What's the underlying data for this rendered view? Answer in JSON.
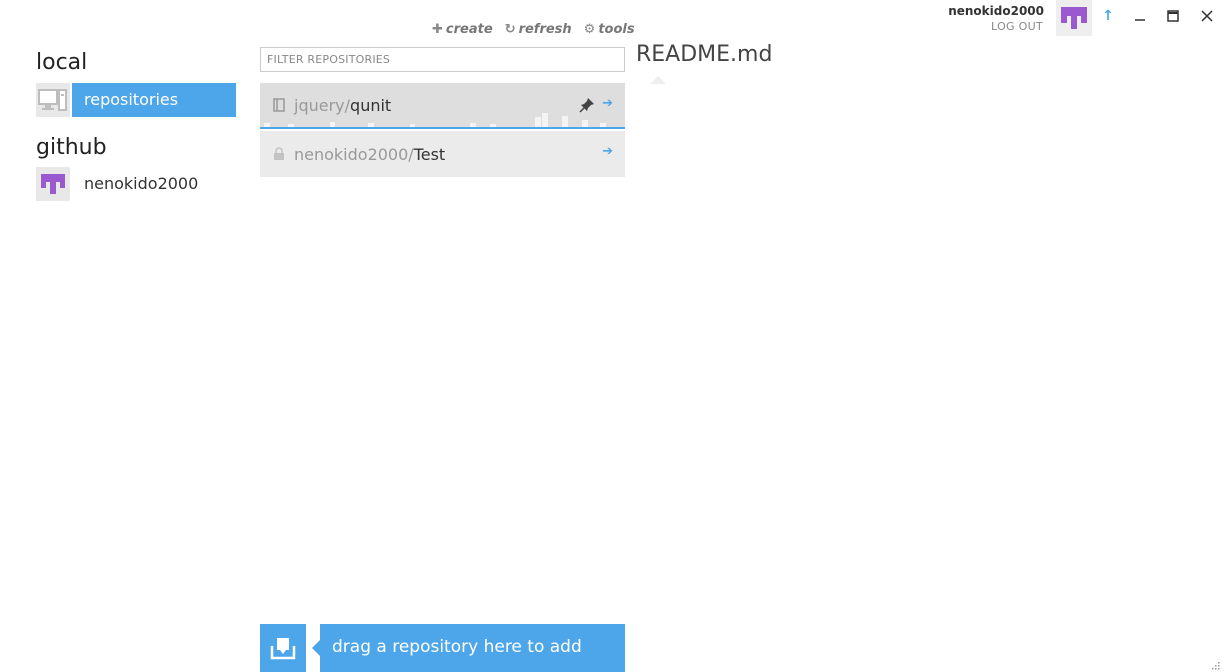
{
  "sidebar": {
    "local_title": "local",
    "local_items": [
      {
        "label": "repositories",
        "icon": "computer-icon",
        "selected": true
      }
    ],
    "github_title": "github",
    "github_items": [
      {
        "label": "nenokido2000",
        "icon": "avatar"
      }
    ]
  },
  "toolbar": {
    "create_label": "create",
    "refresh_label": "refresh",
    "tools_label": "tools"
  },
  "filter": {
    "placeholder": "FILTER REPOSITORIES",
    "value": ""
  },
  "repositories": [
    {
      "owner": "jquery/",
      "name": "qunit",
      "icon": "book-icon",
      "selected": true,
      "pinned": true
    },
    {
      "owner": "nenokido2000/",
      "name": "Test",
      "icon": "lock-icon",
      "selected": false,
      "pinned": false
    }
  ],
  "readme": {
    "title": "README.md"
  },
  "account": {
    "username": "nenokido2000",
    "logout_label": "LOG OUT"
  },
  "dropzone": {
    "label": "drag a repository here to add"
  },
  "colors": {
    "accent": "#4ea6ea",
    "avatar": "#9b59d0",
    "selected_bg": "#dedede",
    "item_bg": "#ebebeb"
  }
}
